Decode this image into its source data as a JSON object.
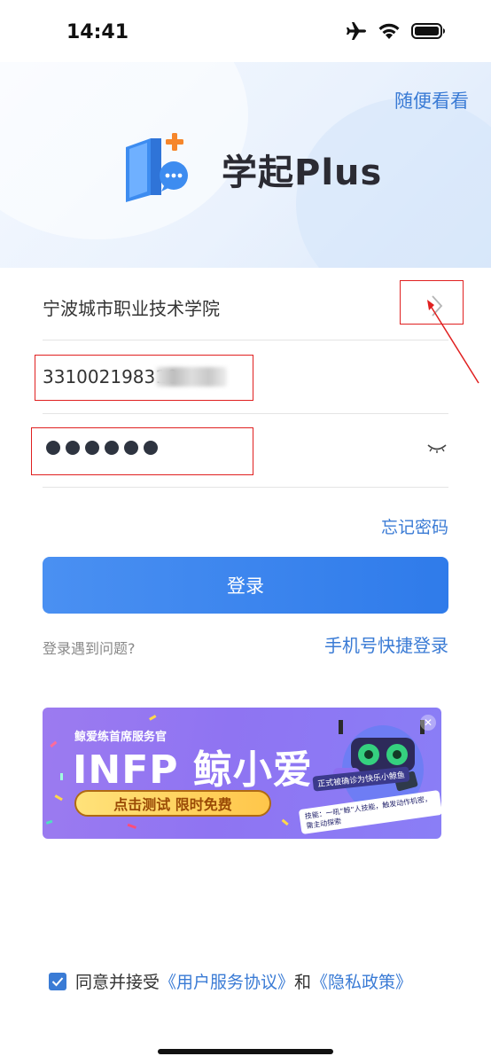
{
  "status_bar": {
    "time": "14:41"
  },
  "header": {
    "browse_link": "随便看看",
    "app_name": "学起Plus"
  },
  "form": {
    "school": "宁波城市职业技术学院",
    "account_value": "331002198310",
    "password_mask_count": 6,
    "forgot_password": "忘记密码",
    "login_button": "登录",
    "help_link": "登录遇到问题?",
    "phone_login": "手机号快捷登录"
  },
  "banner": {
    "subtitle": "鲸爱练首席服务官",
    "title": "INFP 鲸小爱",
    "cta": "点击测试 限时免费",
    "badge": "正式被确诊为快乐小鲸鱼",
    "skill": "技能：一吼“鲸”人技能，触发动作机密，需主动探索",
    "close": "✕"
  },
  "agreement": {
    "checked": true,
    "prefix": "同意并接受",
    "user_agreement": "《用户服务协议》",
    "and": "和",
    "privacy_policy": "《隐私政策》"
  },
  "colors": {
    "accent": "#3a7bd5",
    "annotation": "#e02020"
  },
  "icons": [
    "airplane-icon",
    "wifi-icon",
    "battery-icon",
    "app-logo-icon",
    "chevron-right-icon",
    "eye-closed-icon",
    "checkbox-checked-icon",
    "close-icon"
  ]
}
